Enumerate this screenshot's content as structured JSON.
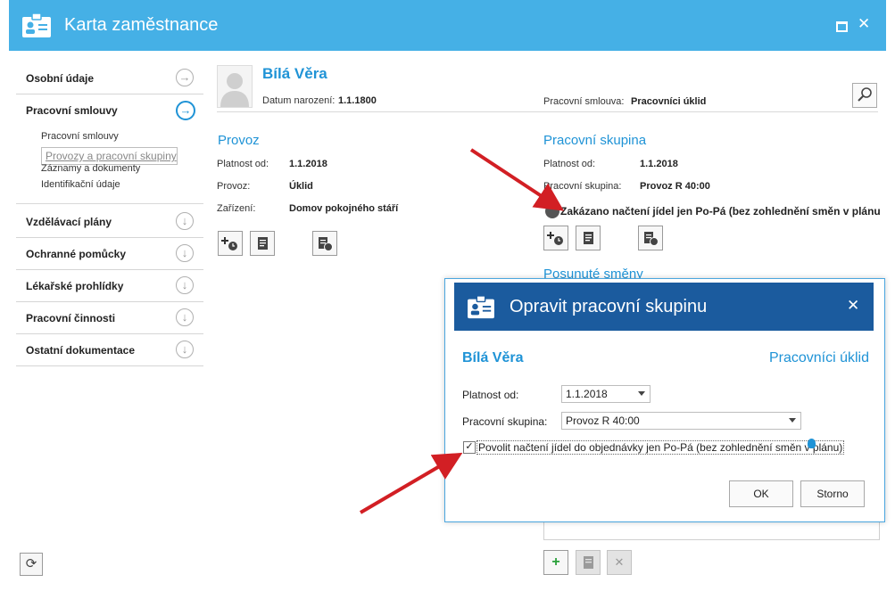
{
  "window": {
    "title": "Karta zaměstnance",
    "close_glyph": "✕"
  },
  "sidebar": {
    "items": [
      {
        "label": "Osobní údaje"
      },
      {
        "label": "Pracovní smlouvy"
      },
      {
        "label": "Vzdělávací plány"
      },
      {
        "label": "Ochranné pomůcky"
      },
      {
        "label": "Lékařské prohlídky"
      },
      {
        "label": "Pracovní činnosti"
      },
      {
        "label": "Ostatní dokumentace"
      }
    ],
    "subitems": [
      {
        "label": "Pracovní smlouvy"
      },
      {
        "label": "Provozy a pracovní skupiny"
      },
      {
        "label": "Záznamy a dokumenty"
      },
      {
        "label": "Identifikační údaje"
      }
    ]
  },
  "employee": {
    "name": "Bílá Věra",
    "birth_label": "Datum narození:",
    "birth_value": "1.1.1800",
    "contract_label": "Pracovní smlouva:",
    "contract_value": "Pracovníci úklid"
  },
  "provoz": {
    "title": "Provoz",
    "rows": [
      {
        "label": "Platnost od:",
        "value": "1.1.2018"
      },
      {
        "label": "Provoz:",
        "value": "Úklid"
      },
      {
        "label": "Zařízení:",
        "value": "Domov pokojného stáří"
      }
    ]
  },
  "skupina": {
    "title": "Pracovní skupina",
    "rows": [
      {
        "label": "Platnost od:",
        "value": "1.1.2018"
      },
      {
        "label": "Pracovní skupina:",
        "value": "Provoz R 40:00"
      }
    ],
    "toggle_text": "Zakázano načtení jídel jen Po-Pá (bez zohlednění směn v plánu"
  },
  "shifted": {
    "title": "Posunuté směny"
  },
  "dialog": {
    "title": "Opravit pracovní skupinu",
    "close_glyph": "✕",
    "name": "Bílá Věra",
    "contract": "Pracovníci úklid",
    "valid_from_label": "Platnost od:",
    "valid_from_value": "1.1.2018",
    "group_label": "Pracovní skupina:",
    "group_value": "Provoz R 40:00",
    "checkbox_label": "Povolit načtení jídel do objednávky jen Po-Pá (bez zohlednění směn v plánu)",
    "checkbox_checked": true,
    "ok_label": "OK",
    "cancel_label": "Storno"
  },
  "colors": {
    "accent": "#1f93d6",
    "titlebar": "#45b0e6",
    "dialog_header": "#1b5b9e",
    "arrow": "#d21f24"
  }
}
